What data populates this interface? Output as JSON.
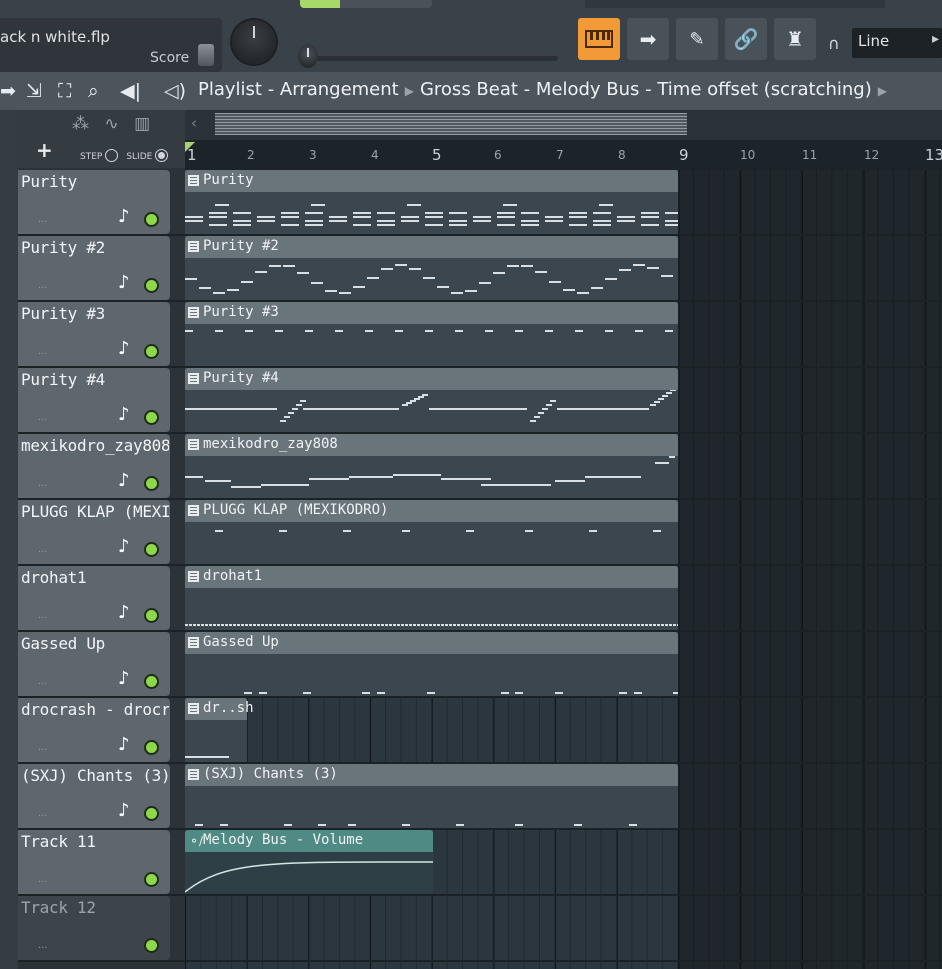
{
  "toolbar": {
    "file_name": "ack n white.flp",
    "score_label": "Score",
    "snap_mode": "Line",
    "colors": {
      "accent": "#f29a38",
      "led": "#8cd84a"
    }
  },
  "titlebar": {
    "crumbs": [
      "Playlist - Arrangement",
      "Gross Beat - Melody Bus - Time offset (scratching)"
    ]
  },
  "header": {
    "plus_label": "+",
    "step_label": "STEP",
    "slide_label": "SLIDE"
  },
  "ruler": {
    "bars": [
      "1",
      "2",
      "3",
      "4",
      "5",
      "6",
      "7",
      "8",
      "9",
      "10",
      "11",
      "12",
      "13"
    ]
  },
  "tracks": [
    {
      "name": "Purity",
      "clip": "Purity"
    },
    {
      "name": "Purity #2",
      "clip": "Purity #2"
    },
    {
      "name": "Purity #3",
      "clip": "Purity #3"
    },
    {
      "name": "Purity #4",
      "clip": "Purity #4"
    },
    {
      "name": "mexikodro_zay808",
      "clip": "mexikodro_zay808"
    },
    {
      "name": "PLUGG KLAP (MEXI...",
      "clip": "PLUGG KLAP (MEXIKODRO)"
    },
    {
      "name": "drohat1",
      "clip": "drohat1"
    },
    {
      "name": "Gassed Up",
      "clip": "Gassed Up"
    },
    {
      "name": "drocrash - drocra...",
      "clip": "dr..sh"
    },
    {
      "name": "(SXJ) Chants (3)",
      "clip": "(SXJ) Chants (3)"
    },
    {
      "name": "Track 11",
      "clip": "Melody Bus - Volume"
    },
    {
      "name": "Track 12",
      "clip": ""
    }
  ]
}
